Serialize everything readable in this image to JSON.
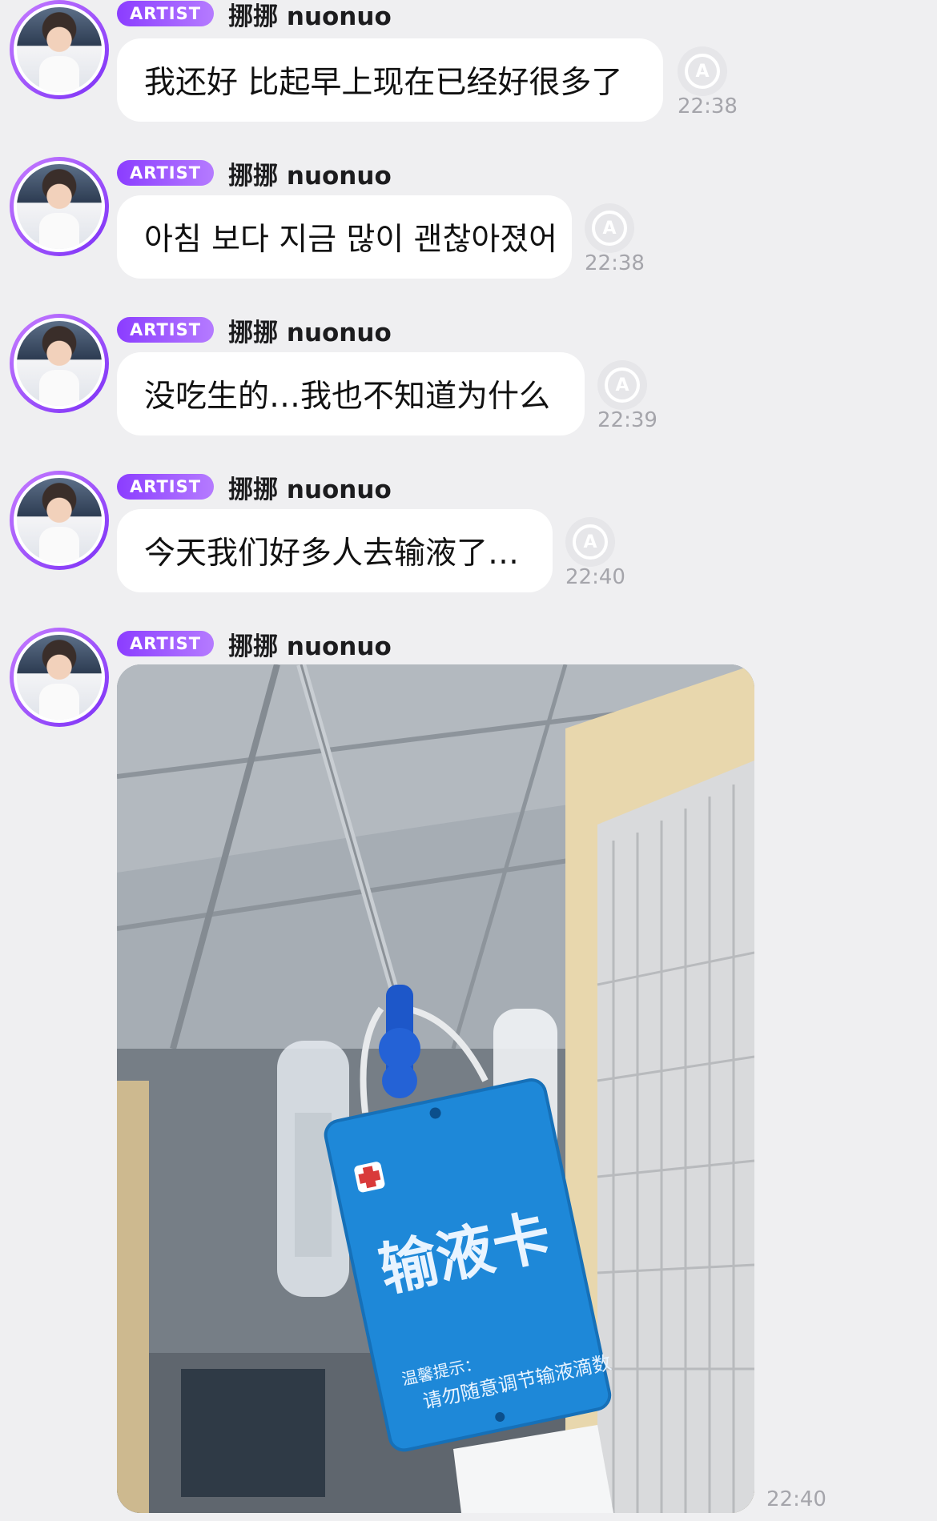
{
  "messages": [
    {
      "badge": "ARTIST",
      "sender": "挪挪 nuonuo",
      "text": "我还好 比起早上现在已经好很多了",
      "time": "22:38"
    },
    {
      "badge": "ARTIST",
      "sender": "挪挪 nuonuo",
      "text": "아침 보다 지금 많이 괜찮아졌어",
      "time": "22:38"
    },
    {
      "badge": "ARTIST",
      "sender": "挪挪 nuonuo",
      "text": "没吃生的…我也不知道为什么",
      "time": "22:39"
    },
    {
      "badge": "ARTIST",
      "sender": "挪挪 nuonuo",
      "text": "今天我们好多人去输液了…",
      "time": "22:40"
    },
    {
      "badge": "ARTIST",
      "sender": "挪挪 nuonuo",
      "time": "22:40",
      "photo": {
        "card_title": "输液卡",
        "card_note_label": "温馨提示：",
        "card_note": "请勿随意调节输液滴数"
      }
    }
  ],
  "icons": {
    "avatar": "avatar-image",
    "translate": "translate-icon"
  },
  "colors": {
    "background": "#efeff1",
    "badge": "#8b3dff",
    "bubble": "#ffffff",
    "timestamp": "#a5a5ab"
  }
}
